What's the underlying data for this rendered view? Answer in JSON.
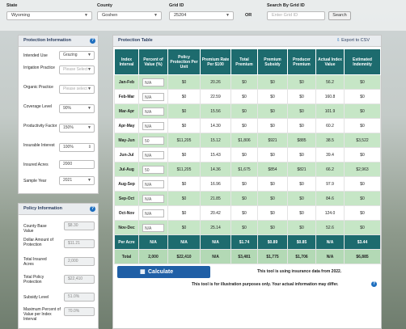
{
  "filters": {
    "state_label": "State",
    "state_value": "Wyoming",
    "county_label": "County",
    "county_value": "Goshen",
    "grid_label": "Grid ID",
    "grid_value": "25204",
    "or_label": "OR",
    "search_label": "Search By Grid ID",
    "search_placeholder": "Enter Grid ID",
    "search_button": "Search"
  },
  "protection_info": {
    "title": "Protection Information",
    "intended_use_label": "Intended Use",
    "intended_use_value": "Grazing",
    "irrigation_label": "Irrigation Practice",
    "irrigation_value": "Please Select",
    "organic_label": "Organic Practice",
    "organic_value": "Please select",
    "coverage_label": "Coverage Level",
    "coverage_value": "90%",
    "productivity_label": "Productivity Factor",
    "productivity_value": "150%",
    "insurable_label": "Insurable Interest",
    "insurable_value": "100%",
    "insured_acres_label": "Insured Acres",
    "insured_acres_value": "2000",
    "sample_year_label": "Sample Year",
    "sample_year_value": "2021"
  },
  "policy_info": {
    "title": "Policy Information",
    "county_base_label": "County Base Value",
    "county_base_value": "$8.30",
    "dollar_amount_label": "Dollar Amount of Protection",
    "dollar_amount_value": "$11.21",
    "total_acres_label": "Total Insured Acres",
    "total_acres_value": "2,000",
    "total_policy_label": "Total Policy Protection",
    "total_policy_value": "$22,410",
    "subsidy_label": "Subsidy Level",
    "subsidy_value": "51.0%",
    "max_percent_label": "Maximum Percent of Value per Index Interval",
    "max_percent_value": "70.0%"
  },
  "protection_table": {
    "title": "Protection Table",
    "export_label": "Export to CSV",
    "headers": [
      "Index Interval",
      "Percent of Value (%)",
      "Policy Protection Per Unit",
      "Premium Rate Per $100",
      "Total Premium",
      "Premium Subsidy",
      "Producer Premium",
      "Actual Index Value",
      "Estimated Indemnity"
    ],
    "rows": [
      {
        "interval": "Jan-Feb",
        "pct": "N/A",
        "protection": "$0",
        "rate": "20.26",
        "total": "$0",
        "subsidy": "$0",
        "producer": "$0",
        "actual": "56.2",
        "indemnity": "$0"
      },
      {
        "interval": "Feb-Mar",
        "pct": "N/A",
        "protection": "$0",
        "rate": "22.59",
        "total": "$0",
        "subsidy": "$0",
        "producer": "$0",
        "actual": "160.8",
        "indemnity": "$0"
      },
      {
        "interval": "Mar-Apr",
        "pct": "N/A",
        "protection": "$0",
        "rate": "15.56",
        "total": "$0",
        "subsidy": "$0",
        "producer": "$0",
        "actual": "101.9",
        "indemnity": "$0"
      },
      {
        "interval": "Apr-May",
        "pct": "N/A",
        "protection": "$0",
        "rate": "14.30",
        "total": "$0",
        "subsidy": "$0",
        "producer": "$0",
        "actual": "60.2",
        "indemnity": "$0"
      },
      {
        "interval": "May-Jun",
        "pct": "50",
        "protection": "$11,205",
        "rate": "15.12",
        "total": "$1,806",
        "subsidy": "$921",
        "producer": "$885",
        "actual": "38.5",
        "indemnity": "$3,522"
      },
      {
        "interval": "Jun-Jul",
        "pct": "N/A",
        "protection": "$0",
        "rate": "15.43",
        "total": "$0",
        "subsidy": "$0",
        "producer": "$0",
        "actual": "39.4",
        "indemnity": "$0"
      },
      {
        "interval": "Jul-Aug",
        "pct": "50",
        "protection": "$11,205",
        "rate": "14.36",
        "total": "$1,675",
        "subsidy": "$854",
        "producer": "$821",
        "actual": "66.2",
        "indemnity": "$2,963"
      },
      {
        "interval": "Aug-Sep",
        "pct": "N/A",
        "protection": "$0",
        "rate": "16.96",
        "total": "$0",
        "subsidy": "$0",
        "producer": "$0",
        "actual": "97.9",
        "indemnity": "$0"
      },
      {
        "interval": "Sep-Oct",
        "pct": "N/A",
        "protection": "$0",
        "rate": "21.85",
        "total": "$0",
        "subsidy": "$0",
        "producer": "$0",
        "actual": "84.6",
        "indemnity": "$0"
      },
      {
        "interval": "Oct-Nov",
        "pct": "N/A",
        "protection": "$0",
        "rate": "20.42",
        "total": "$0",
        "subsidy": "$0",
        "producer": "$0",
        "actual": "124.0",
        "indemnity": "$0"
      },
      {
        "interval": "Nov-Dec",
        "pct": "N/A",
        "protection": "$0",
        "rate": "25.14",
        "total": "$0",
        "subsidy": "$0",
        "producer": "$0",
        "actual": "52.6",
        "indemnity": "$0"
      }
    ],
    "per_acre": [
      "Per Acre",
      "N/A",
      "N/A",
      "N/A",
      "$1.74",
      "$0.89",
      "$0.85",
      "N/A",
      "$3.44"
    ],
    "total": [
      "Total",
      "2,000",
      "$22,410",
      "N/A",
      "$3,481",
      "$1,775",
      "$1,706",
      "N/A",
      "$6,885"
    ]
  },
  "calculate_label": "Calculate",
  "note1": "This tool is using insurance data from 2022.",
  "note2": "This tool is for illustration purposes only. Your actual information may differ.",
  "colors": {
    "header_teal": "#1d6b6e",
    "row_green": "#c6e6c6",
    "button_blue": "#1f5fa6"
  }
}
